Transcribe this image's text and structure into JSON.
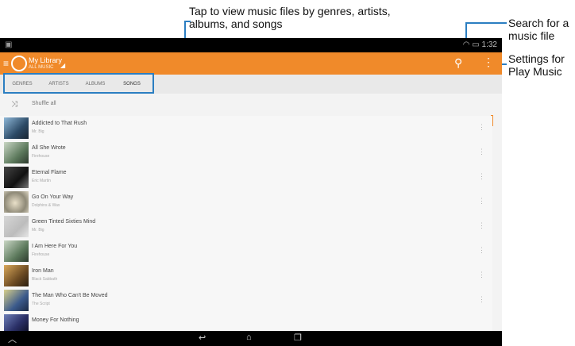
{
  "annotations": {
    "tabs_note": "Tap to view music files by genres, artists, albums, and songs",
    "search_note": "Search for a music file",
    "settings_note": "Settings for Play Music"
  },
  "status_bar": {
    "time": "1:32"
  },
  "action_bar": {
    "title": "My Library",
    "subtitle": "ALL MUSIC"
  },
  "tabs": [
    {
      "label": "GENRES",
      "active": false
    },
    {
      "label": "ARTISTS",
      "active": false
    },
    {
      "label": "ALBUMS",
      "active": false
    },
    {
      "label": "SONGS",
      "active": true
    }
  ],
  "shuffle_label": "Shuffle all",
  "songs": [
    {
      "title": "Addicted to That Rush",
      "artist": "Mr. Big"
    },
    {
      "title": "All She Wrote",
      "artist": "Firehouse"
    },
    {
      "title": "Eternal Flame",
      "artist": "Eric Martin"
    },
    {
      "title": "Go On Your Way",
      "artist": "Dolphins & Wax"
    },
    {
      "title": "Green Tinted Sixties Mind",
      "artist": "Mr. Big"
    },
    {
      "title": "I Am Here For You",
      "artist": "Firehouse"
    },
    {
      "title": "Iron Man",
      "artist": "Black Sabbath"
    },
    {
      "title": "The Man Who Can't Be Moved",
      "artist": "The Script"
    },
    {
      "title": "Money For Nothing",
      "artist": ""
    }
  ],
  "colors": {
    "accent": "#f08a2a",
    "callout": "#2b7ec1",
    "status_bar": "#000000"
  },
  "icons": {
    "search": "search-icon",
    "more": "overflow-menu-icon",
    "shuffle": "shuffle-icon",
    "back": "back-icon",
    "home": "home-icon",
    "recents": "recent-apps-icon"
  }
}
